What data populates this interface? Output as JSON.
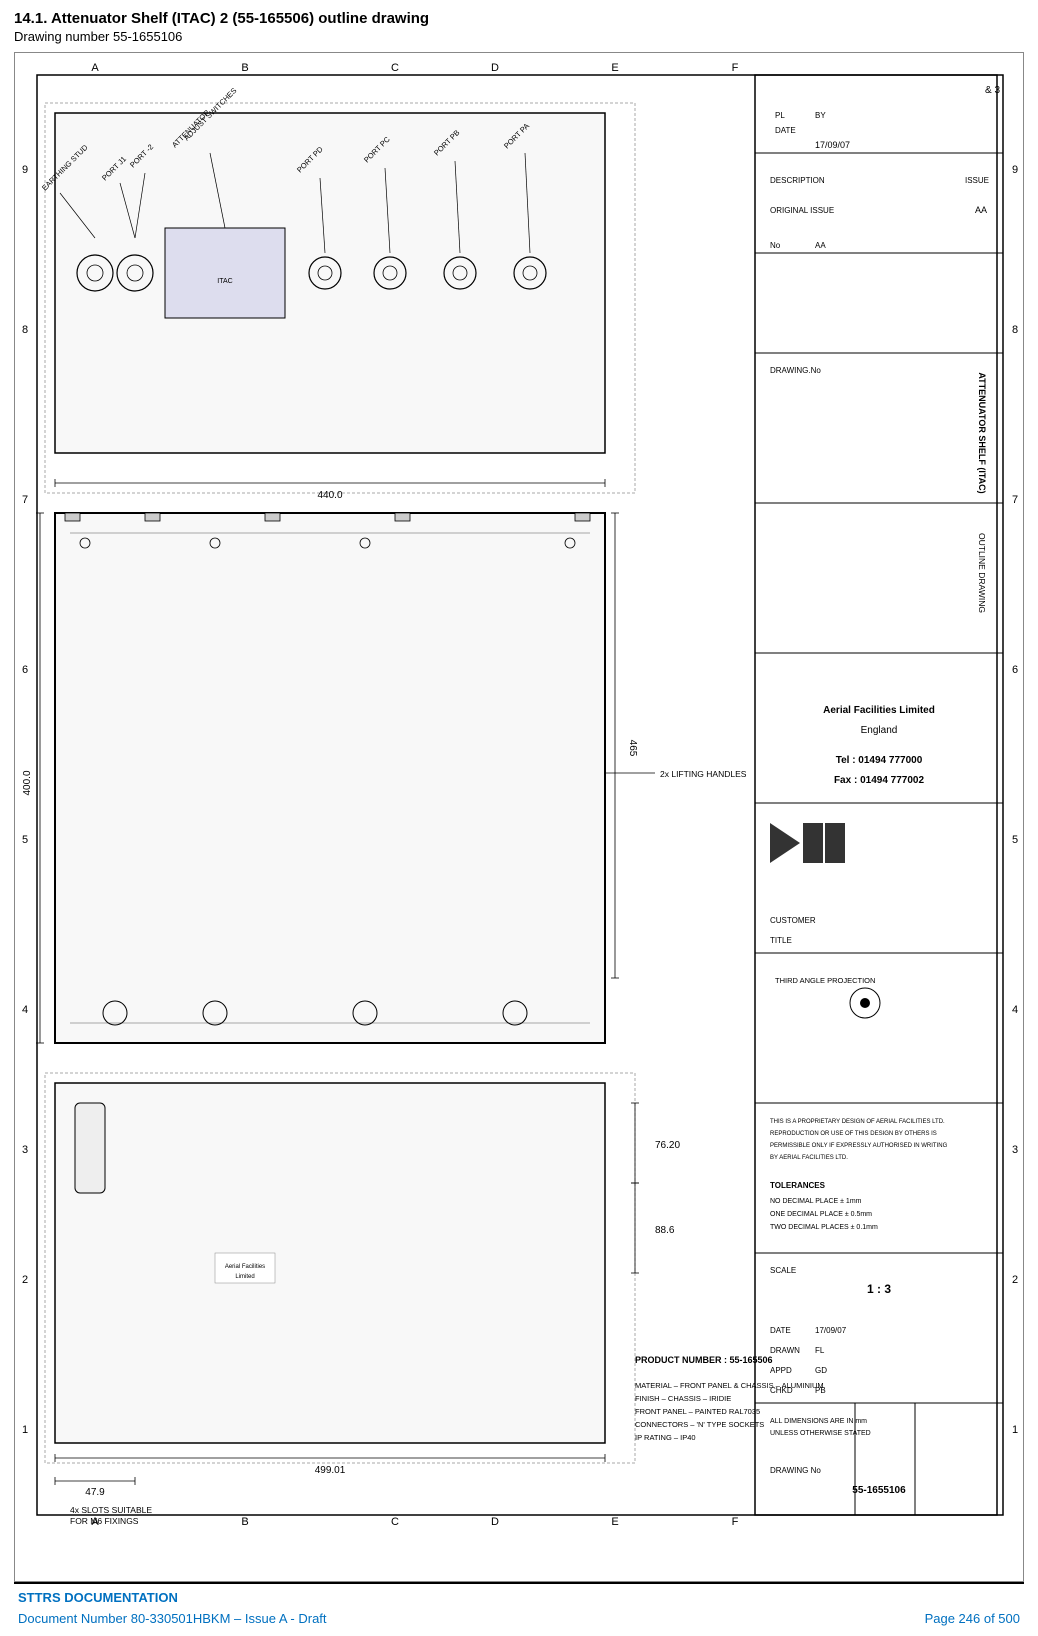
{
  "page": {
    "title": "14.1. Attenuator Shelf (ITAC) 2 (55-165506) outline drawing",
    "drawing_number_label": "Drawing number 55-1655106"
  },
  "footer": {
    "sttrs": "STTRS DOCUMENTATION",
    "doc_number": "Document Number 80-330501HBKM – Issue A - Draft",
    "page_info": "Page 246 of 500"
  },
  "drawing": {
    "product_number": "PRODUCT NUMBER : 55-165506",
    "title_block": {
      "title": "ATTENUATOR SHELF (ITAC)",
      "subtitle": "OUTLINE DRAWING",
      "drawing_no": "55-1655106",
      "scale": "1 : 3",
      "date": "17/09/07",
      "company": "Aerial Facilities Limited",
      "company_location": "England",
      "tel": "Tel : 01494 777000",
      "fax": "Fax : 01494 777002",
      "projection": "THIRD ANGLE PROJECTION"
    },
    "dimensions": {
      "width_top": "440.0",
      "height_left": "400.0",
      "dim_465": "465",
      "dim_76_20": "76.20",
      "dim_88_6": "88.6",
      "dim_499_01": "499.01",
      "dim_47_9": "47.9"
    },
    "labels": {
      "port_j1": "PORT J1",
      "port_2": "PORT -2",
      "attenuator_adjust": "ATTENUATOR ADJUST SWITCHES",
      "earthing_stud": "EARTHING STUD",
      "port_pd": "PORT PD",
      "port_pc": "PORT PC",
      "port_pb": "PORT PB",
      "port_pa": "PORT PA",
      "lifting_handles": "2x LIFTING HANDLES",
      "slots": "4x SLOTS SUITABLE FOR M6 FIXINGS",
      "material": "MATERIAL – FRONT PANEL & CHASSIS – ALUMINIUM",
      "finish": "FINISH – CHASSIS – IRIDIE",
      "front_panel": "FRONT PANEL – PAINTED RAL7035",
      "connectors": "CONNECTORS – 'N' TYPE SOCKETS",
      "ip_rating": "IP RATING – IP40"
    }
  }
}
